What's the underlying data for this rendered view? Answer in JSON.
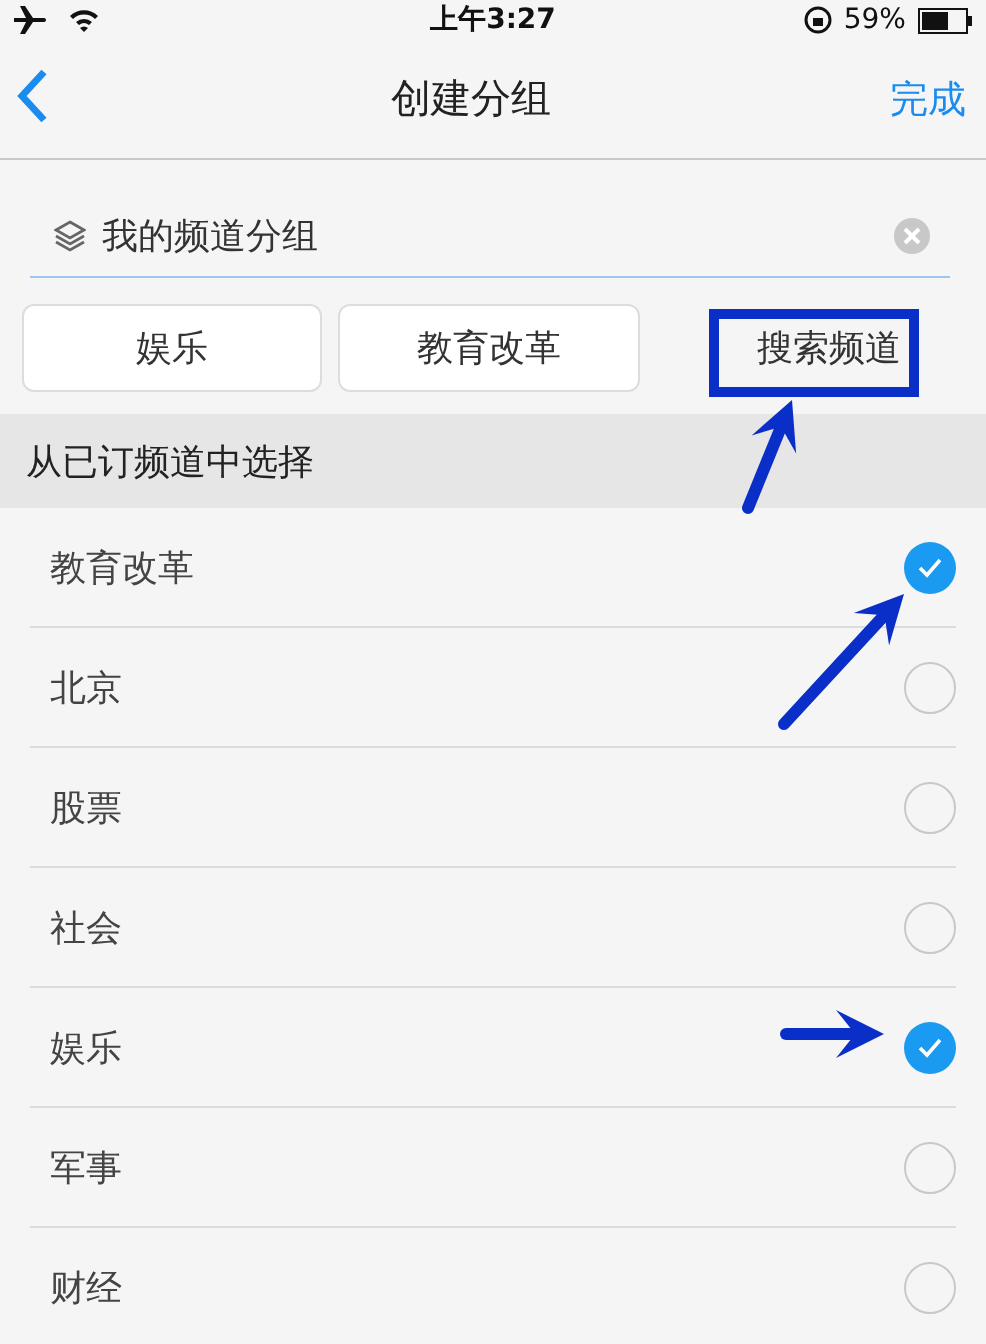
{
  "status_bar": {
    "time": "上午3:27",
    "battery": "59%"
  },
  "nav": {
    "title": "创建分组",
    "done": "完成"
  },
  "group_field": {
    "value": "我的频道分组"
  },
  "chips": [
    {
      "label": "娱乐",
      "kind": "chip"
    },
    {
      "label": "教育改革",
      "kind": "chip"
    },
    {
      "label": "搜索频道",
      "kind": "search"
    }
  ],
  "section": {
    "title": "从已订频道中选择"
  },
  "channels": [
    {
      "name": "教育改革",
      "selected": true
    },
    {
      "name": "北京",
      "selected": false
    },
    {
      "name": "股票",
      "selected": false
    },
    {
      "name": "社会",
      "selected": false
    },
    {
      "name": "娱乐",
      "selected": true
    },
    {
      "name": "军事",
      "selected": false
    },
    {
      "name": "财经",
      "selected": false
    }
  ]
}
